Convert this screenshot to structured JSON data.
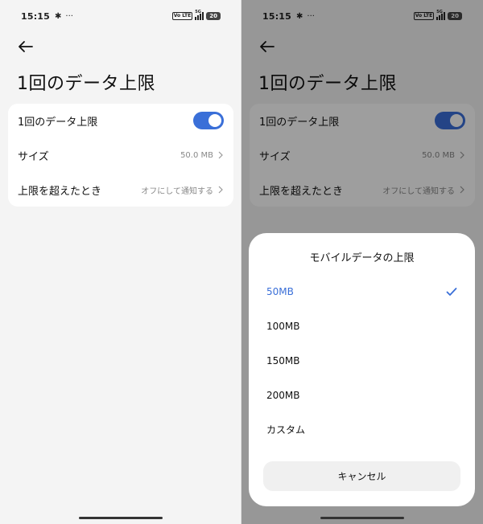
{
  "status": {
    "time": "15:15",
    "dots": "···",
    "network": "5G",
    "volte": "Vo LTE",
    "battery": "20"
  },
  "page": {
    "title": "1回のデータ上限"
  },
  "settings": {
    "limit_label": "1回のデータ上限",
    "limit_enabled": true,
    "size_label": "サイズ",
    "size_value": "50.0 MB",
    "exceed_label": "上限を超えたとき",
    "exceed_value": "オフにして通知する"
  },
  "sheet": {
    "title": "モバイルデータの上限",
    "options": [
      {
        "label": "50MB",
        "selected": true
      },
      {
        "label": "100MB",
        "selected": false
      },
      {
        "label": "150MB",
        "selected": false
      },
      {
        "label": "200MB",
        "selected": false
      },
      {
        "label": "カスタム",
        "selected": false
      }
    ],
    "cancel_label": "キャンセル"
  },
  "colors": {
    "accent": "#3a6fd8",
    "background": "#f4f4f4",
    "card": "#ffffff"
  }
}
